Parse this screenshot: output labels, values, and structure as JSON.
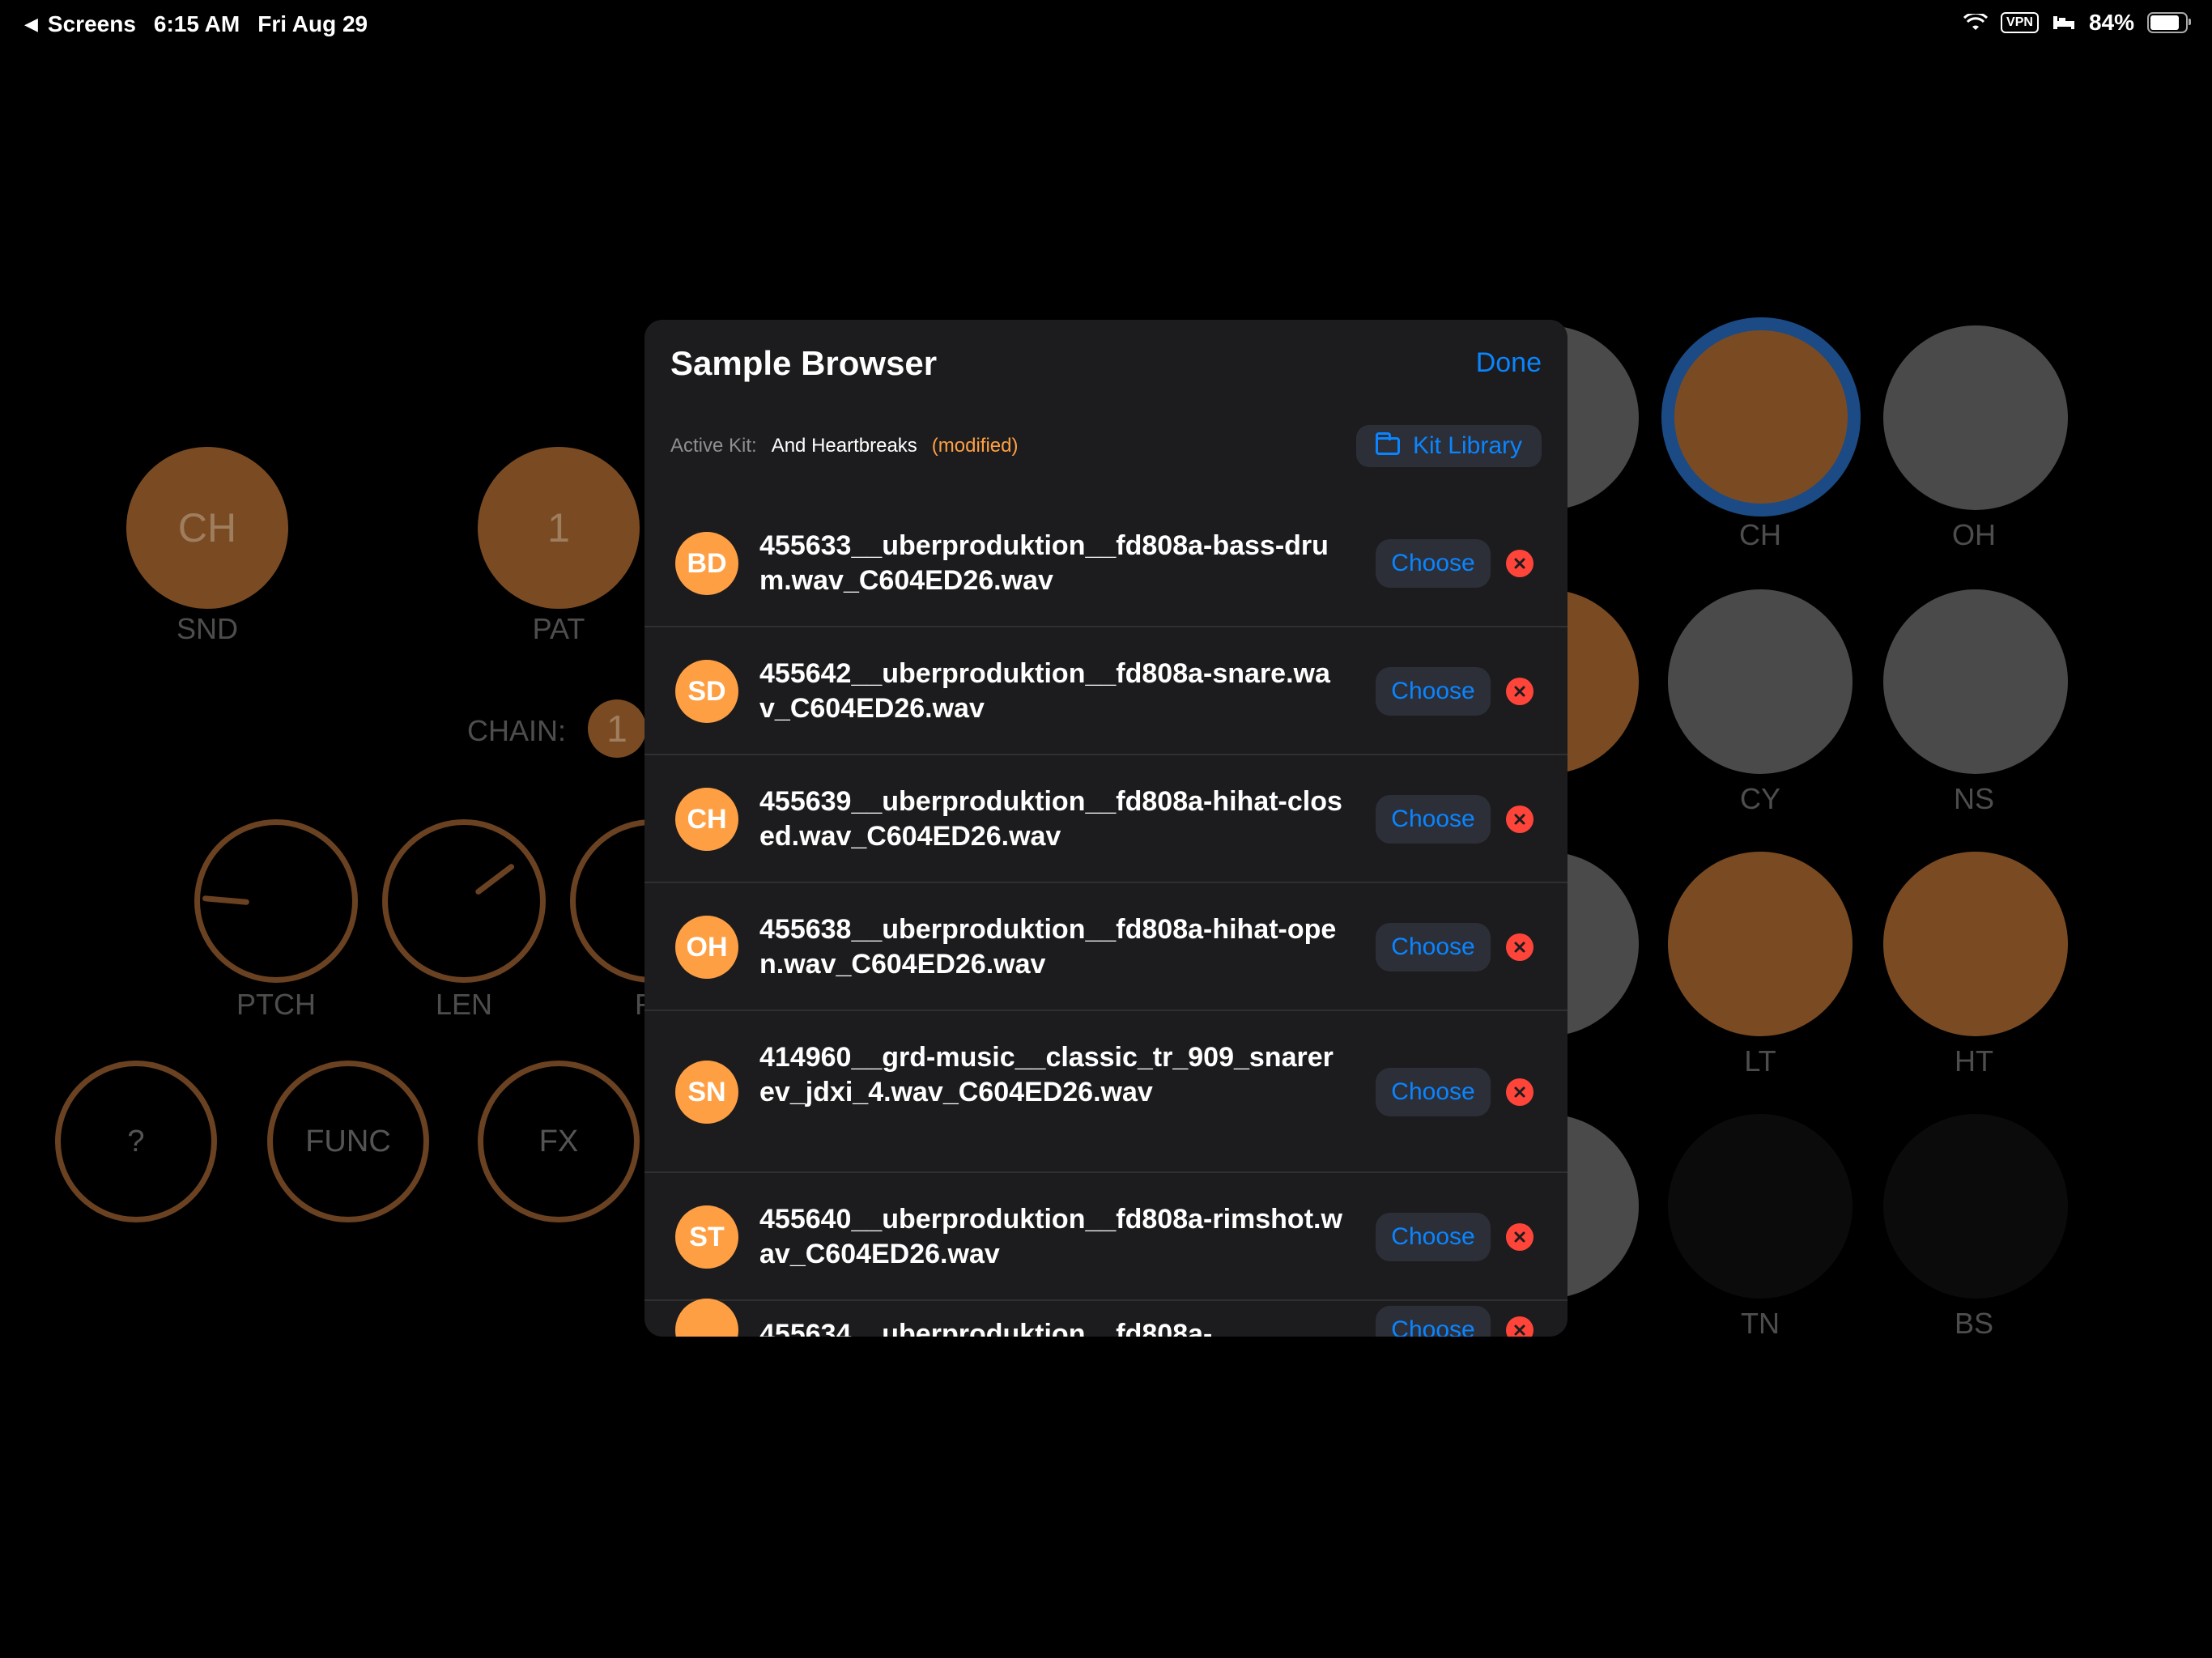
{
  "status_bar": {
    "back_label": "Screens",
    "time": "6:15 AM",
    "date": "Fri Aug 29",
    "vpn": "VPN",
    "battery": "84%",
    "battery_level": 0.84
  },
  "background": {
    "snd_value": "CH",
    "snd_label": "SND",
    "pat_value": "1",
    "pat_label": "PAT",
    "chain_label": "CHAIN:",
    "chain_value": "1",
    "knobs": [
      "PTCH",
      "LEN",
      "FL"
    ],
    "buttons": [
      "?",
      "FUNC",
      "FX"
    ],
    "pads": [
      "CH",
      "OH",
      "CY",
      "NS",
      "LT",
      "HT",
      "TN",
      "BS"
    ]
  },
  "modal": {
    "title": "Sample Browser",
    "done": "Done",
    "active_kit_label": "Active Kit:",
    "kit_name": "And Heartbreaks",
    "modified": "(modified)",
    "kit_library": "Kit Library",
    "choose_label": "Choose",
    "samples": [
      {
        "badge": "BD",
        "name": "455633__uberproduktion__fd808a-bass-drum.wav_C604ED26.wav"
      },
      {
        "badge": "SD",
        "name": "455642__uberproduktion__fd808a-snare.wav_C604ED26.wav"
      },
      {
        "badge": "CH",
        "name": "455639__uberproduktion__fd808a-hihat-closed.wav_C604ED26.wav"
      },
      {
        "badge": "OH",
        "name": "455638__uberproduktion__fd808a-hihat-open.wav_C604ED26.wav"
      },
      {
        "badge": "SN",
        "name": "414960__grd-music__classic_tr_909_snarerev_jdxi_4.wav_C604ED26.wav"
      },
      {
        "badge": "ST",
        "name": "455640__uberproduktion__fd808a-rimshot.wav_C604ED26.wav"
      },
      {
        "badge": "",
        "name": "455634__uberproduktion__fd808a-"
      }
    ]
  }
}
